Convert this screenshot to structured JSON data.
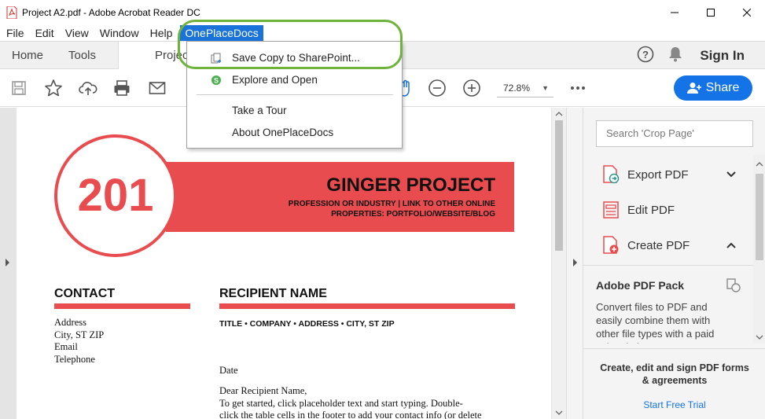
{
  "window": {
    "title": "Project A2.pdf - Adobe Acrobat Reader DC"
  },
  "menubar": {
    "items": [
      "File",
      "Edit",
      "View",
      "Window",
      "Help",
      "OnePlaceDocs"
    ]
  },
  "tabs": {
    "home": "Home",
    "tools": "Tools",
    "document": "Project A2.pdf",
    "sign_in": "Sign In"
  },
  "toolbar": {
    "zoom": "72.8%",
    "share": "Share"
  },
  "dropdown": {
    "items": [
      "Save Copy to SharePoint...",
      "Explore and Open",
      "Take a Tour",
      "About OnePlaceDocs"
    ]
  },
  "document": {
    "number": "201",
    "name": "GINGER PROJECT",
    "subtitle1": "PROFESSION OR INDUSTRY | LINK TO OTHER ONLINE",
    "subtitle2": "PROPERTIES: PORTFOLIO/WEBSITE/BLOG",
    "contact_heading": "CONTACT",
    "contact_lines": [
      "Address",
      "City, ST ZIP",
      "Email",
      "Telephone"
    ],
    "recipient_heading": "RECIPIENT NAME",
    "title_line": "TITLE  •  COMPANY  •  ADDRESS  •  CITY, ST ZIP",
    "date": "Date",
    "salutation": "Dear Recipient Name,",
    "body1": "To get started, click placeholder text and start typing. Double-",
    "body2": "click the table cells in the footer to add your contact info (or delete"
  },
  "right_pane": {
    "search_placeholder": "Search 'Crop Page'",
    "tools": [
      "Export PDF",
      "Edit PDF",
      "Create PDF"
    ],
    "pack_title": "Adobe PDF Pack",
    "pack_desc": "Convert files to PDF and easily combine them with other file types with a paid subscription.",
    "promo_text": "Create, edit and sign PDF forms & agreements",
    "promo_link": "Start Free Trial"
  },
  "colors": {
    "accent": "#e84c4f",
    "brand_blue": "#1473e6",
    "menu_highlight": "#1a73d8",
    "annotation_green": "#6fb33d"
  }
}
